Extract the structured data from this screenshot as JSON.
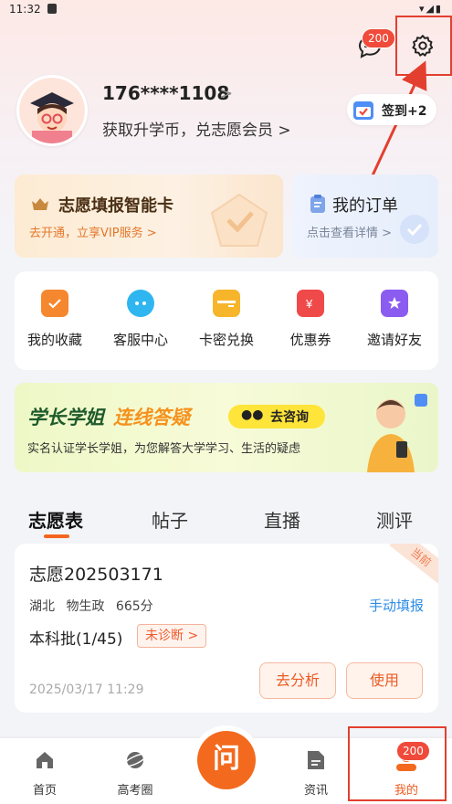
{
  "status_bar": {
    "time": "11:32"
  },
  "header": {
    "message_badge": "200"
  },
  "profile": {
    "phone": "176****1108",
    "phone_chevron": ">",
    "promo": "获取升学币，兑志愿会员 >",
    "signin_label": "签到+2"
  },
  "cards": {
    "vip": {
      "title": "志愿填报智能卡",
      "subtitle": "去开通，立享VIP服务 >"
    },
    "orders": {
      "title": "我的订单",
      "subtitle": "点击查看详情 >"
    }
  },
  "quick_actions": [
    {
      "label": "我的收藏",
      "icon": "folder-icon",
      "color": "#f5872f"
    },
    {
      "label": "客服中心",
      "icon": "chat-icon",
      "color": "#2fb6f0"
    },
    {
      "label": "卡密兑换",
      "icon": "card-icon",
      "color": "#f7b52b"
    },
    {
      "label": "优惠券",
      "icon": "coupon-icon",
      "color": "#f0494a"
    },
    {
      "label": "邀请好友",
      "icon": "star-icon",
      "color": "#8b5cf0"
    }
  ],
  "banner": {
    "title_part1": "学长学姐",
    "title_part2": "连线答疑",
    "cta": "去咨询",
    "subtitle": "实名认证学长学姐，为您解答大学学习、生活的疑虑"
  },
  "tabs": [
    "志愿表",
    "帖子",
    "直播",
    "测评"
  ],
  "plan": {
    "name": "志愿202503171",
    "province": "湖北",
    "subjects": "物生政",
    "score": "665分",
    "manual_fill": "手动填报",
    "batch": "本科批(1/45)",
    "diagnosis": "未诊断 >",
    "timestamp": "2025/03/17 11:29",
    "corner_tag": "当前",
    "analyze_label": "去分析",
    "use_label": "使用"
  },
  "bottom_nav": {
    "home": "首页",
    "circle": "高考圈",
    "center": "问",
    "news": "资讯",
    "mine": "我的",
    "mine_badge": "200"
  },
  "colors": {
    "accent": "#f36a1e",
    "highlight_red": "#e33f2f",
    "link_blue": "#2d8ce6"
  }
}
